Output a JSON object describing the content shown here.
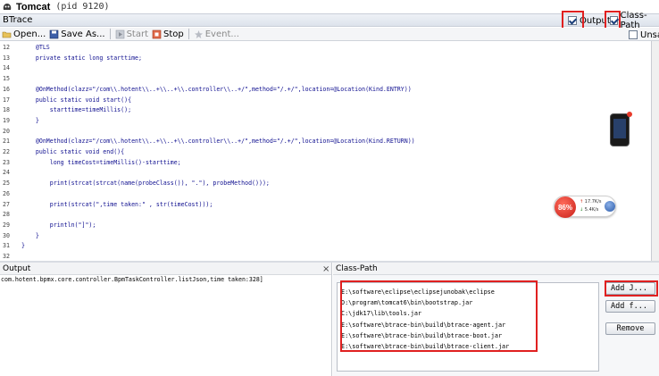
{
  "window": {
    "title": "Tomcat",
    "pid": "(pid 9120)"
  },
  "btrace": {
    "panel_label": "BTrace",
    "output_checkbox": {
      "label": "Output",
      "checked": true
    },
    "classpath_checkbox": {
      "label": "Class-Path",
      "checked": true
    }
  },
  "toolbar": {
    "open_label": "Open...",
    "save_label": "Save As...",
    "start_label": "Start",
    "stop_label": "Stop",
    "event_label": "Event...",
    "unsafe_label": "Unsaf"
  },
  "editor": {
    "lines": [
      {
        "n": "12",
        "text": "    @TLS"
      },
      {
        "n": "13",
        "text": "    private static long starttime;"
      },
      {
        "n": "14",
        "text": ""
      },
      {
        "n": "15",
        "text": ""
      },
      {
        "n": "16",
        "text": "    @OnMethod(clazz=\"/com\\\\.hotent\\\\..+\\\\..+\\\\.controller\\\\..+/\",method=\"/.+/\",location=@Location(Kind.ENTRY))"
      },
      {
        "n": "17",
        "text": "    public static void start(){"
      },
      {
        "n": "18",
        "text": "        starttime=timeMillis();"
      },
      {
        "n": "19",
        "text": "    }"
      },
      {
        "n": "20",
        "text": ""
      },
      {
        "n": "21",
        "text": "    @OnMethod(clazz=\"/com\\\\.hotent\\\\..+\\\\..+\\\\.controller\\\\..+/\",method=\"/.+/\",location=@Location(Kind.RETURN))"
      },
      {
        "n": "22",
        "text": "    public static void end(){"
      },
      {
        "n": "23",
        "text": "        long timeCost=timeMillis()-starttime;"
      },
      {
        "n": "24",
        "text": ""
      },
      {
        "n": "25",
        "text": "        print(strcat(strcat(name(probeClass()), \".\"), probeMethod()));"
      },
      {
        "n": "26",
        "text": ""
      },
      {
        "n": "27",
        "text": "        print(strcat(\",time taken:\" , str(timeCost)));"
      },
      {
        "n": "28",
        "text": ""
      },
      {
        "n": "29",
        "text": "        println(\"]\");"
      },
      {
        "n": "30",
        "text": "    }"
      },
      {
        "n": "31",
        "text": "}"
      },
      {
        "n": "32",
        "text": ""
      }
    ]
  },
  "gauge": {
    "percent_label": "86%",
    "upload": "17.7K/s",
    "download": "5.4K/s"
  },
  "output_panel": {
    "title": "Output",
    "text": "com.hotent.bpmx.core.controller.BpmTaskController.listJson,time taken:328]"
  },
  "classpath_panel": {
    "title": "Class-Path",
    "entries": [
      "E:\\software\\eclipse\\eclipsejunobak\\eclipse",
      "D:\\program\\tomcat6\\bin\\bootstrap.jar",
      "C:\\jdk17\\lib\\tools.jar",
      "E:\\software\\btrace-bin\\build\\btrace-agent.jar",
      "E:\\software\\btrace-bin\\build\\btrace-boot.jar",
      "E:\\software\\btrace-bin\\build\\btrace-client.jar"
    ],
    "add_jar_label": "Add J...",
    "add_folder_label": "Add f...",
    "remove_label": "Remove"
  },
  "colors": {
    "highlight": "#e02020",
    "gauge_red": "#c8201a",
    "code_blue": "#101090"
  }
}
